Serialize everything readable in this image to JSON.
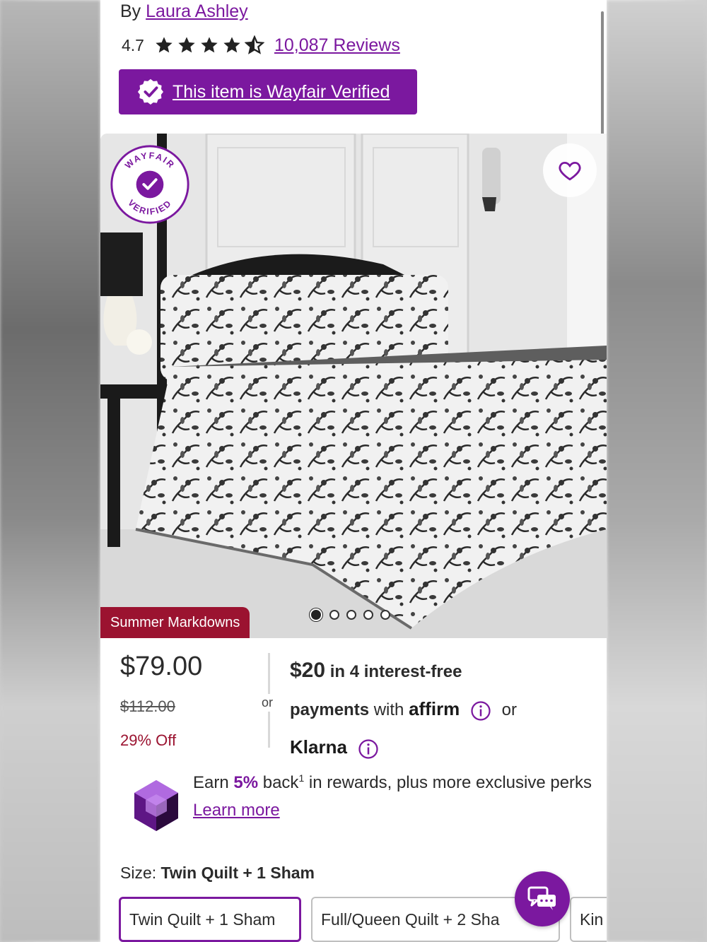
{
  "product": {
    "by_prefix": "By",
    "brand": "Laura Ashley",
    "rating": "4.7",
    "reviews_label": "10,087 Reviews",
    "verified_label": "This item is Wayfair Verified"
  },
  "hero": {
    "badge_text_top": "WAYFAIR",
    "badge_text_bottom": "VERIFIED",
    "tag_label": "Summer Markdowns",
    "slide_count": 5,
    "active_slide": 1
  },
  "pricing": {
    "current": "$79.00",
    "original": "$112.00",
    "discount": "29% Off",
    "or_label": "or",
    "installment_amount": "$20",
    "installment_text": " in 4 interest-free",
    "payments_word": "payments",
    "with_word": " with ",
    "affirm_label": "affirm",
    "or_word": "or",
    "klarna_label": "Klarna"
  },
  "rewards": {
    "earn": "Earn ",
    "percent": "5%",
    "back": " back",
    "footnote": "1",
    "rest": " in rewards, plus more exclusive perks",
    "learn_more": "Learn more"
  },
  "size": {
    "label": "Size: ",
    "selected_value": "Twin Quilt + 1 Sham",
    "options": [
      "Twin Quilt + 1 Sham",
      "Full/Queen Quilt + 2 Sha",
      "Kin"
    ]
  },
  "colors": {
    "brand_purple": "#7b189f",
    "markdown_red": "#9b1330"
  },
  "icons": {
    "star": "star-icon",
    "verified": "checkmark-badge-icon",
    "heart": "heart-icon",
    "info": "info-icon",
    "gem": "rewards-gem-icon",
    "chat": "chat-icon"
  }
}
